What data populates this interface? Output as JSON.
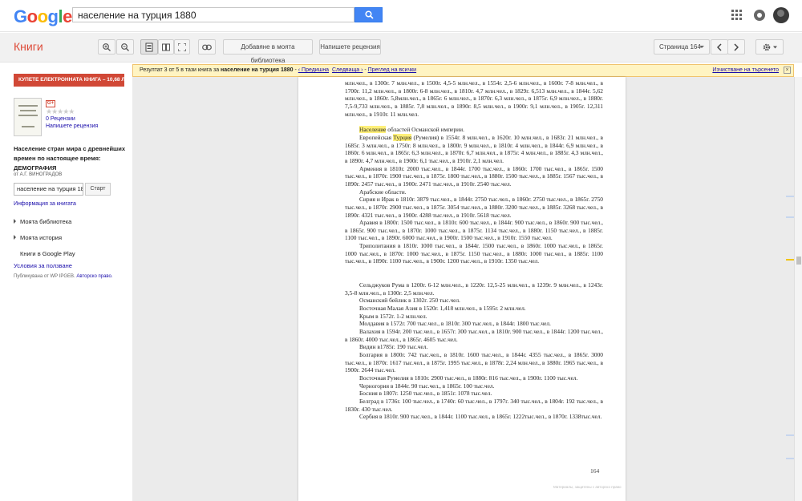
{
  "header": {
    "logo_letters": [
      {
        "ch": "G",
        "color": "#4285f4"
      },
      {
        "ch": "o",
        "color": "#ea4335"
      },
      {
        "ch": "o",
        "color": "#fbbc05"
      },
      {
        "ch": "g",
        "color": "#4285f4"
      },
      {
        "ch": "l",
        "color": "#34a853"
      },
      {
        "ch": "e",
        "color": "#ea4335"
      }
    ],
    "search_value": "население на турция 1880"
  },
  "toolbar": {
    "title": "Книги",
    "add_library": "Добавяне в моята библиотека",
    "write_review": "Напишете рецензия",
    "page_select": "Страница 164"
  },
  "result_bar": {
    "prefix": "Резултат 3 от 5 в тази книга за ",
    "query": "население на турция 1880",
    "sep": " - ",
    "prev": "‹ Предишна",
    "next": "Следваща ›",
    "view_all": "Преглед на всички",
    "clear": "Изчистване на търсенето",
    "close": "×"
  },
  "sidebar": {
    "buy_button": "КУПЕТЕ ЕЛЕКТРОННАТА КНИГА – 10,68 ЛВ",
    "gplus": "G+",
    "stars": "★★★★★",
    "reviews": "0 Рецензии",
    "write_review": "Напишете рецензия",
    "book_title": "Население стран мира с древнейших времен по настоящее время: ДЕМОГРАФИЯ",
    "author": "от А.Г. ВИНОГРАДОВ",
    "search_value": "население на турция 18",
    "start_button": "Старт",
    "book_info": "Информация за книгата",
    "my_library": "Моята библиотека",
    "my_history": "Моята история",
    "google_play": "Книги в Google Play",
    "terms": "Условия за ползване",
    "published": "Публикувана от WP IPGEB.",
    "copyright": "Авторско право."
  },
  "page": {
    "paragraphs": [
      {
        "text": "млн.чел., в 1300г. 7 млн.чел., в 1500г. 4,5-5 млн.чел., в 1554г. 2,5-6 млн.чел., в 1600г. 7-8 млн.чел., в 1700г. 11,2 млн.чел., в 1800г. 6-8 млн.чел., в 1810г. 4,7 млн.чел., в 1829г. 6,513 млн.чел., в 1844г. 5,62 млн.чел., в 1860г. 5,8млн.чел., в 1865г. 6 млн.чел., в 1870г. 6,3 млн.чел., в 1875г. 6,9 млн.чел., в 1880г. 7,5-9,733 млн.чел., в 1885г. 7,8 млн.чел., в 1890г. 8,5 млн.чел., в 1900г. 9,1 млн.чел., в 1905г. 12,311 млн.чел., в 1910г. 11 млн.чел."
      },
      {
        "text": "",
        "gap": true
      },
      {
        "hl": "Население",
        "text": " областей Османской империи.",
        "indent": true
      },
      {
        "text": "Европейская ",
        "hl2": "Турция",
        "text2": " (Румелия) в 1554г. 8 млн.чел., в 1620г. 10 млн.чел., в 1683г. 21 млн.чел., в 1685г. 3 млн.чел., в 1750г. 8 млн.чел., в 1800г. 9 млн.чел., в 1810г. 4 млн.чел., в 1844г. 6,9 млн.чел., в 1860г. 6 млн.чел., в 1865г. 6,3 млн.чел., в 1870г. 6,7 млн.чел., в 1875г. 4 млн.чел., в 1885г. 4,3 млн.чел., в 1890г. 4,7 млн.чел., в 1900г. 6,1 тыс.чел., в 1910г. 2,1 млн.чел.",
        "indent": true
      },
      {
        "text": "Армения в 1810г. 2000 тыс.чел., в 1844г. 1700 тыс.чел., в 1860г. 1700 тыс.чел., в 1865г. 1500 тыс.чел., в 1870г. 1900 тыс.чел., в 1875г. 1800 тыс.чел., в 1880г. 1500 тыс.чел., в 1885г. 1567 тыс.чел., в 1890г. 2457 тыс.чел., в 1900г. 2471 тыс.чел., в 1910г. 2540 тыс.чел.",
        "indent": true
      },
      {
        "text": "Арабские области.",
        "indent": true
      },
      {
        "text": "Сирия и Ирак в 1810г. 3879 тыс.чел., в 1844г. 2750 тыс.чел., в 1860г. 2750 тыс.чел., в 1865г. 2750 тыс.чел., в 1870г. 2900 тыс.чел., в 1875г. 3054 тыс.чел., в 1880г. 3200 тыс.чел., в 1885г. 3268 тыс.чел., в 1890г. 4321 тыс.чел., в 1900г. 4288 тыс.чел., в 1910г. 5618 тыс.чел.",
        "indent": true
      },
      {
        "text": "Аравия в 1800г. 1500 тыс.чел., в 1810г. 600 тыс.чел., в 1844г. 900 тыс.чел., в 1860г. 900 тыс.чел., в 1865г. 900 тыс.чел., в 1870г. 1000 тыс.чел., в 1875г. 1134 тыс.чел., в 1880г. 1150 тыс.чел., в 1885г. 1100 тыс.чел., в 1890г. 6000 тыс.чел., в 1900г. 1500 тыс.чел., в 1910г. 1550 тыс.чел.",
        "indent": true
      },
      {
        "text": "Триполитания в 1810г. 1000 тыс.чел., в 1844г. 1500 тыс.чел., в 1860г. 1000 тыс.чел., в 1865г. 1000 тыс.чел., в 1870г. 1000 тыс.чел., в 1875г. 1150 тыс.чел., в 1880г. 1000 тыс.чел., в 1885г. 1100 тыс.чел., в 1890г. 1100 тыс.чел., в 1900г. 1200 тыс.чел., в 1910г. 1350 тыс.чел.",
        "indent": true
      },
      {
        "text": "",
        "gap": true
      },
      {
        "text": "",
        "gap": true
      },
      {
        "text": "Сельджуков Рума в 1200г. 6-12 млн.чел., в 1220г. 12,5-25 млн.чел., в 1239г. 9 млн.чел., в 1243г. 3,5-8 млн.чел., в 1300г. 2,5 млн.чел.",
        "indent": true
      },
      {
        "text": "Османский бейлик в 1302г. 250 тыс.чел.",
        "indent": true
      },
      {
        "text": "Восточная Малая Азия в 1520г. 1,418 млн.чел., в 1595г. 2 млн.чел.",
        "indent": true
      },
      {
        "text": "Крым в 1572г. 1-2 млн.чел.",
        "indent": true
      },
      {
        "text": "Молдавия в 1572г. 700 тыс.чел., в 1810г. 300 тыс.чел., в 1844г. 1800 тыс.чел.",
        "indent": true
      },
      {
        "text": "Валахия в 1594г. 200 тыс.чел., в 1657г. 300 тыс.чел., в 1810г. 900 тыс.чел., в 1844г. 1200 тыс.чел., в 1860г. 4000 тыс.чел., в 1865г. 4605 тыс.чел.",
        "indent": true
      },
      {
        "text": "Видин в1785г. 190 тыс.чел.",
        "indent": true
      },
      {
        "text": "Болгария в 1800г. 742 тыс.чел., в 1810г. 1600 тыс.чел., в 1844г. 4355 тыс.чел., в 1865г. 3000 тыс.чел., в 1870г. 1617 тыс.чел., в 1875г. 1995 тыс.чел., в 1878г. 2,24 млн.чел., в 1880г. 1965 тыс.чел., в 1900г. 2644 тыс.чел.",
        "indent": true
      },
      {
        "text": "Восточная Румелия в 1810г. 2900 тыс.чел., в 1880г. 816 тыс.чел., в 1900г. 1100 тыс.чел.",
        "indent": true
      },
      {
        "text": "Черногория в 1844г. 90 тыс.чел., в 1865г. 100 тыс.чел.",
        "indent": true
      },
      {
        "text": "Босния в 1807г. 1250 тыс.чел., в 1851г. 1078 тыс.чел.",
        "indent": true
      },
      {
        "text": "Белград в 1736г. 100 тыс.чел., в 1740г. 60 тыс.чел., в 1797г. 340 тыс.чел., в 1804г. 192 тыс.чел., в 1830г. 430 тыс.чел.",
        "indent": true
      },
      {
        "text": "Сербия в 1810г. 900 тыс.чел., в 1844г. 1100 тыс.чел., в 1865г. 1222тыс.чел., в 1870г. 1338тыс.чел.",
        "indent": true
      }
    ],
    "page_number": "164",
    "copyright": "Материалы, защитены с авторско право"
  },
  "colors": {
    "brand_red": "#dd4b39",
    "search_blue": "#4285f4",
    "highlight": "#fff07a",
    "result_bar_bg": "#fff4c2"
  }
}
